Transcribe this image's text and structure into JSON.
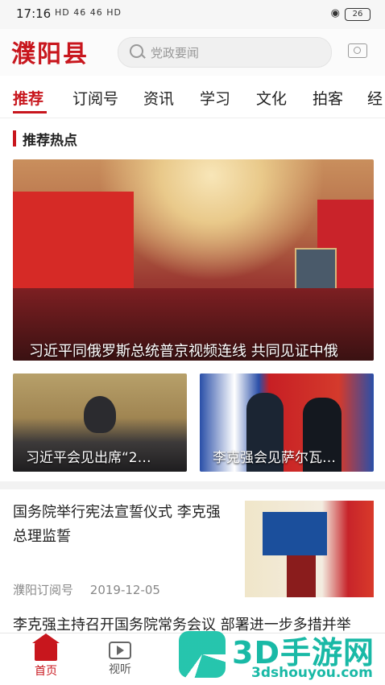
{
  "status_bar": {
    "time": "17:16",
    "signal_text": "HD  46  46  HD",
    "battery": "26"
  },
  "header": {
    "logo": "濮阳县",
    "search_placeholder": "党政要闻"
  },
  "tabs": [
    {
      "label": "推荐",
      "active": true
    },
    {
      "label": "订阅号",
      "active": false
    },
    {
      "label": "资讯",
      "active": false
    },
    {
      "label": "学习",
      "active": false
    },
    {
      "label": "文化",
      "active": false
    },
    {
      "label": "拍客",
      "active": false
    },
    {
      "label": "经",
      "active": false
    }
  ],
  "section": {
    "title": "推荐热点"
  },
  "featured": {
    "big": {
      "caption": "习近平同俄罗斯总统普京视频连线 共同见证中俄"
    },
    "small": [
      {
        "caption": "习近平会见出席“2…"
      },
      {
        "caption": "李克强会见萨尔瓦…"
      }
    ]
  },
  "news": [
    {
      "title": "国务院举行宪法宣誓仪式 李克强总理监誓",
      "source": "濮阳订阅号",
      "date": "2019-12-05"
    },
    {
      "title": "李克强主持召开国务院常务会议 部署进一步多措并举"
    }
  ],
  "bottom_nav": [
    {
      "label": "首页",
      "icon": "home-icon",
      "active": true
    },
    {
      "label": "视听",
      "icon": "video-icon",
      "active": false
    }
  ],
  "watermark": {
    "brand": "3D手游网",
    "url": "3dshouyou.com"
  },
  "colors": {
    "accent": "#c8161d",
    "watermark": "#19b9a6"
  }
}
